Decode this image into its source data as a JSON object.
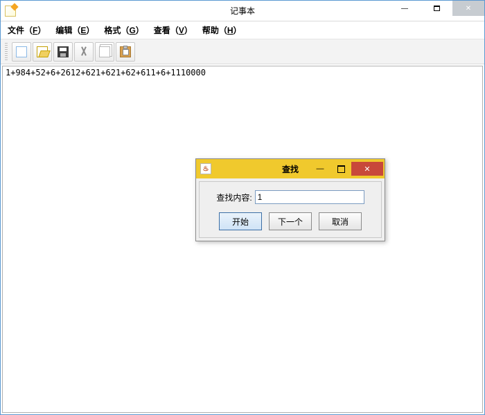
{
  "window": {
    "title": "记事本"
  },
  "menu": {
    "file": "文件（F）",
    "edit": "编辑（E）",
    "format": "格式（G）",
    "view": "查看（V）",
    "help": "帮助（H）"
  },
  "menu_keys": {
    "file": "F",
    "edit": "E",
    "format": "G",
    "view": "V",
    "help": "H"
  },
  "editor": {
    "content": "1+984+52+6+2612+621+621+62+611+6+1110000"
  },
  "dialog": {
    "title": "查找",
    "label": "查找内容:",
    "value": "1",
    "start": "开始",
    "next": "下一个",
    "cancel": "取消"
  },
  "icons": {
    "java_glyph": "♨",
    "min_glyph": "—",
    "close_glyph": "✕"
  }
}
